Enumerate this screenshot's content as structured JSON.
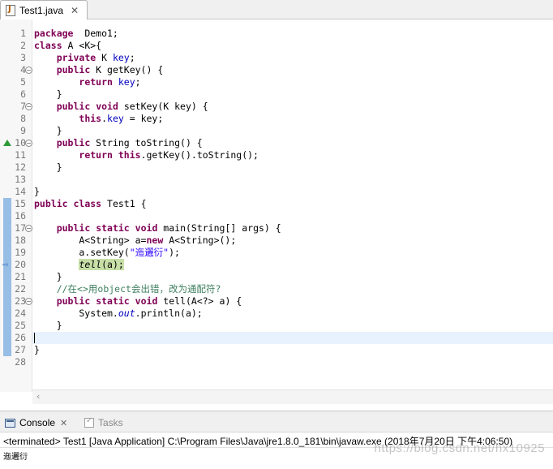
{
  "editor_tab": {
    "label": "Test1.java",
    "close_glyph": "✕",
    "icon": "java-file-icon"
  },
  "code_lines": [
    {
      "num": "1",
      "tokens": [
        [
          "kw",
          "package"
        ],
        [
          "",
          "  Demo1;"
        ]
      ]
    },
    {
      "num": "2",
      "tokens": [
        [
          "kw",
          "class"
        ],
        [
          "",
          " A <K>{"
        ]
      ]
    },
    {
      "num": "3",
      "tokens": [
        [
          "",
          "    "
        ],
        [
          "kw",
          "private"
        ],
        [
          "",
          " K "
        ],
        [
          "fld",
          "key"
        ],
        [
          "",
          ";"
        ]
      ]
    },
    {
      "num": "4",
      "fold": true,
      "tokens": [
        [
          "",
          "    "
        ],
        [
          "kw",
          "public"
        ],
        [
          "",
          " K getKey() {"
        ]
      ]
    },
    {
      "num": "5",
      "tokens": [
        [
          "",
          "        "
        ],
        [
          "kw",
          "return"
        ],
        [
          "",
          " "
        ],
        [
          "fld",
          "key"
        ],
        [
          "",
          ";"
        ]
      ]
    },
    {
      "num": "6",
      "tokens": [
        [
          "",
          "    }"
        ]
      ]
    },
    {
      "num": "7",
      "fold": true,
      "tokens": [
        [
          "",
          "    "
        ],
        [
          "kw",
          "public"
        ],
        [
          "",
          " "
        ],
        [
          "kw",
          "void"
        ],
        [
          "",
          " setKey(K key) {"
        ]
      ]
    },
    {
      "num": "8",
      "tokens": [
        [
          "",
          "        "
        ],
        [
          "kw",
          "this"
        ],
        [
          "",
          "."
        ],
        [
          "fld",
          "key"
        ],
        [
          "",
          " = key;"
        ]
      ]
    },
    {
      "num": "9",
      "tokens": [
        [
          "",
          "    }"
        ]
      ]
    },
    {
      "num": "10",
      "fold": true,
      "override": true,
      "tokens": [
        [
          "",
          "    "
        ],
        [
          "kw",
          "public"
        ],
        [
          "",
          " String toString() {"
        ]
      ]
    },
    {
      "num": "11",
      "tokens": [
        [
          "",
          "        "
        ],
        [
          "kw",
          "return"
        ],
        [
          "",
          " "
        ],
        [
          "kw",
          "this"
        ],
        [
          "",
          ".getKey().toString();"
        ]
      ]
    },
    {
      "num": "12",
      "tokens": [
        [
          "",
          "    }"
        ]
      ]
    },
    {
      "num": "13",
      "tokens": []
    },
    {
      "num": "14",
      "tokens": [
        [
          "",
          "}"
        ]
      ]
    },
    {
      "num": "15",
      "mark": true,
      "tokens": [
        [
          "kw",
          "public"
        ],
        [
          "",
          " "
        ],
        [
          "kw",
          "class"
        ],
        [
          "",
          " Test1 {"
        ]
      ]
    },
    {
      "num": "16",
      "mark": true,
      "tokens": []
    },
    {
      "num": "17",
      "mark": true,
      "fold": true,
      "tokens": [
        [
          "",
          "    "
        ],
        [
          "kw",
          "public"
        ],
        [
          "",
          " "
        ],
        [
          "kw",
          "static"
        ],
        [
          "",
          " "
        ],
        [
          "kw",
          "void"
        ],
        [
          "",
          " main(String[] args) {"
        ]
      ]
    },
    {
      "num": "18",
      "mark": true,
      "tokens": [
        [
          "",
          "        A<String> a="
        ],
        [
          "kw",
          "new"
        ],
        [
          "",
          " A<String>();"
        ]
      ]
    },
    {
      "num": "19",
      "mark": true,
      "tokens": [
        [
          "",
          "        a.setKey("
        ],
        [
          "str",
          "\"迤邐衍\""
        ],
        [
          "",
          ");"
        ]
      ]
    },
    {
      "num": "20",
      "mark": true,
      "debug": true,
      "tokens": [
        [
          "",
          "        "
        ],
        [
          "it exec-highlight",
          "tell"
        ],
        [
          "exec-highlight",
          "(a);"
        ]
      ]
    },
    {
      "num": "21",
      "mark": true,
      "tokens": [
        [
          "",
          "    }"
        ]
      ]
    },
    {
      "num": "22",
      "mark": true,
      "tokens": [
        [
          "",
          "    "
        ],
        [
          "cmt",
          "//在<>用object会出错，改为通配符?"
        ]
      ]
    },
    {
      "num": "23",
      "mark": true,
      "fold": true,
      "tokens": [
        [
          "",
          "    "
        ],
        [
          "kw",
          "public"
        ],
        [
          "",
          " "
        ],
        [
          "kw",
          "static"
        ],
        [
          "",
          " "
        ],
        [
          "kw",
          "void"
        ],
        [
          "",
          " tell(A<?> a) {"
        ]
      ]
    },
    {
      "num": "24",
      "mark": true,
      "tokens": [
        [
          "",
          "        System."
        ],
        [
          "sfld",
          "out"
        ],
        [
          "",
          ".println(a);"
        ]
      ]
    },
    {
      "num": "25",
      "mark": true,
      "tokens": [
        [
          "",
          "    }"
        ]
      ]
    },
    {
      "num": "26",
      "mark": true,
      "current": true,
      "tokens": []
    },
    {
      "num": "27",
      "mark": true,
      "tokens": [
        [
          "",
          "}"
        ]
      ]
    },
    {
      "num": "28",
      "tokens": []
    }
  ],
  "console_view": {
    "console_label": "Console",
    "console_close_glyph": "✕",
    "tasks_label": "Tasks",
    "status": "<terminated> Test1 [Java Application] C:\\Program Files\\Java\\jre1.8.0_181\\bin\\javaw.exe (2018年7月20日 下午4:06:50)",
    "output": "迤邐衍",
    "watermark": "https://blog.csdn.net/hx10925"
  },
  "colors": {
    "keyword": "#7f0055",
    "field": "#0000c0",
    "string": "#2a00ff",
    "comment": "#3f7f5f",
    "exec_highlight": "#c7dfa7",
    "current_line": "#e8f2fe"
  }
}
